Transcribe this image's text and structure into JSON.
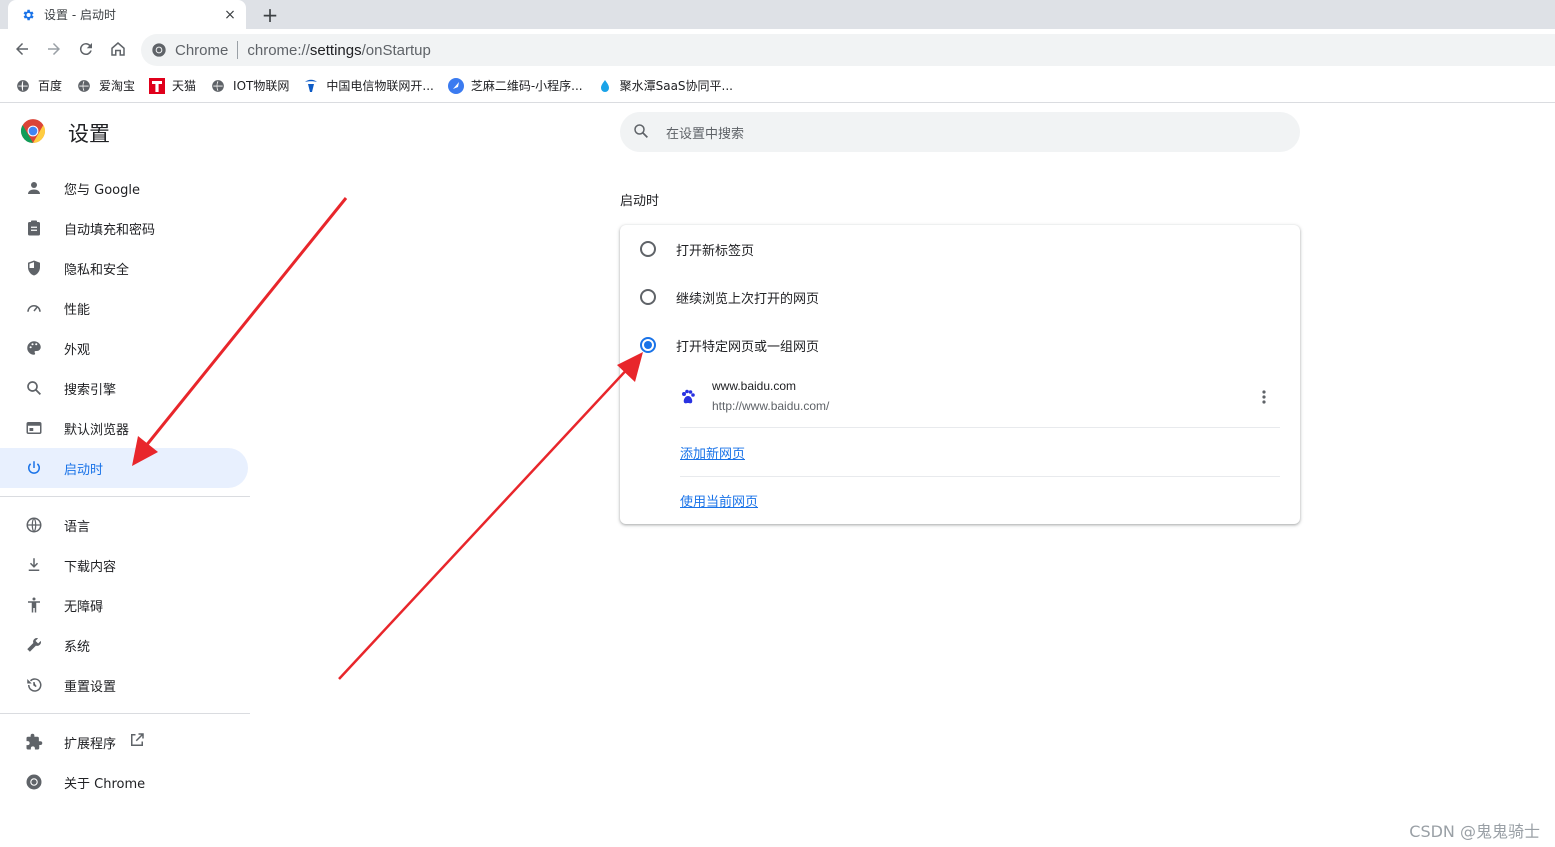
{
  "tab": {
    "title": "设置 - 启动时",
    "close": "×",
    "new_tab": "+"
  },
  "omnibox": {
    "scheme": "Chrome",
    "url_prefix": "chrome://",
    "url_host": "settings",
    "url_path": "/onStartup"
  },
  "bookmarks": [
    {
      "label": "百度",
      "icon": "globe-icon"
    },
    {
      "label": "爱淘宝",
      "icon": "globe-icon"
    },
    {
      "label": "天猫",
      "icon": "tmall-icon"
    },
    {
      "label": "IOT物联网",
      "icon": "globe-icon"
    },
    {
      "label": "中国电信物联网开...",
      "icon": "telecom-icon"
    },
    {
      "label": "芝麻二维码-小程序...",
      "icon": "feather-icon"
    },
    {
      "label": "聚水潭SaaS协同平...",
      "icon": "drop-icon"
    }
  ],
  "settings": {
    "title": "设置"
  },
  "nav": {
    "group1": [
      {
        "label": "您与 Google",
        "icon": "person-icon"
      },
      {
        "label": "自动填充和密码",
        "icon": "clipboard-icon"
      },
      {
        "label": "隐私和安全",
        "icon": "shield-icon"
      },
      {
        "label": "性能",
        "icon": "speedometer-icon"
      },
      {
        "label": "外观",
        "icon": "palette-icon"
      },
      {
        "label": "搜索引擎",
        "icon": "search-icon"
      },
      {
        "label": "默认浏览器",
        "icon": "browser-icon"
      },
      {
        "label": "启动时",
        "icon": "power-icon",
        "active": true
      }
    ],
    "group2": [
      {
        "label": "语言",
        "icon": "globe-icon"
      },
      {
        "label": "下载内容",
        "icon": "download-icon"
      },
      {
        "label": "无障碍",
        "icon": "accessibility-icon"
      },
      {
        "label": "系统",
        "icon": "wrench-icon"
      },
      {
        "label": "重置设置",
        "icon": "restore-icon"
      }
    ],
    "group3": [
      {
        "label": "扩展程序",
        "icon": "puzzle-icon"
      },
      {
        "label": "关于 Chrome",
        "icon": "chrome-icon"
      }
    ]
  },
  "search": {
    "placeholder": "在设置中搜索"
  },
  "startup": {
    "section_title": "启动时",
    "options": [
      {
        "label": "打开新标签页",
        "checked": false
      },
      {
        "label": "继续浏览上次打开的网页",
        "checked": false
      },
      {
        "label": "打开特定网页或一组网页",
        "checked": true
      }
    ],
    "site": {
      "name": "www.baidu.com",
      "url": "http://www.baidu.com/"
    },
    "add_page": "添加新网页",
    "use_current": "使用当前网页"
  },
  "watermark": "CSDN @鬼鬼骑士",
  "colors": {
    "accent": "#1a73e8",
    "active_bg": "#e8f0fe",
    "annotation_arrow": "#e8262b"
  }
}
